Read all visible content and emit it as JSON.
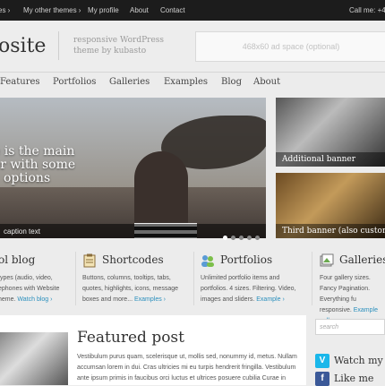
{
  "topbar": {
    "items": [
      "es ›",
      "My other themes ›",
      "My profile",
      "About",
      "Contact"
    ],
    "call": "Call me: +4"
  },
  "header": {
    "logo": "osite",
    "tagline": "responsive WordPress theme by kubasto",
    "ad_text": "468x60 ad space (optional)"
  },
  "nav": {
    "items": [
      {
        "label": "Features",
        "chev": "›"
      },
      {
        "label": "Portfolios",
        "chev": "›"
      },
      {
        "label": "Galleries",
        "chev": "›"
      },
      {
        "label": "Examples",
        "chev": "›"
      },
      {
        "label": "Blog",
        "chev": ""
      },
      {
        "label": "About",
        "chev": ""
      }
    ]
  },
  "slider": {
    "main_text": [
      "e is the main",
      "er with some",
      "options"
    ],
    "caption": "caption text",
    "dots_total": 5,
    "dots_active": 0
  },
  "thumbs": [
    {
      "caption": "Additional banner"
    },
    {
      "caption": "Third banner (also custom"
    }
  ],
  "features": [
    {
      "title": "ol blog",
      "text": "types (audio, video, ephones with Website heme.",
      "link": "Watch blog ›"
    },
    {
      "title": "Shortcodes",
      "text": "Buttons, columns, tooltips, tabs, quotes, highlights, icons, message boxes and more... ",
      "link": "Examples ›"
    },
    {
      "title": "Portfolios",
      "text": "Unlimited portfolio items and portfolios. 4 sizes. Filtering. Video, images and sliders. ",
      "link": "Example ›"
    },
    {
      "title": "Galleries",
      "text": "Four gallery sizes. Fancy Pagination. Everything fu responsive. ",
      "link": "Example gall"
    }
  ],
  "post": {
    "title": "Featured post",
    "text": "Vestibulum purus quam, scelerisque ut, mollis sed, nonummy id, metus. Nullam accumsan lorem in dui. Cras ultricies mi eu turpis hendrerit fringilla. Vestibulum ante ipsum primis in faucibus orci luctus et ultrices posuere cubilia Curae in"
  },
  "sidebar": {
    "search_placeholder": "search",
    "social": [
      {
        "label": "Watch my v",
        "icon": "vimeo-icon",
        "letter": "V",
        "color": "#1ab7ea"
      },
      {
        "label": "Like me",
        "icon": "facebook-icon",
        "letter": "f",
        "color": "#3b5998"
      }
    ]
  },
  "colors": {
    "link": "#2a8fbd",
    "topbar": "#1c1c1c",
    "background": "#ececec"
  }
}
